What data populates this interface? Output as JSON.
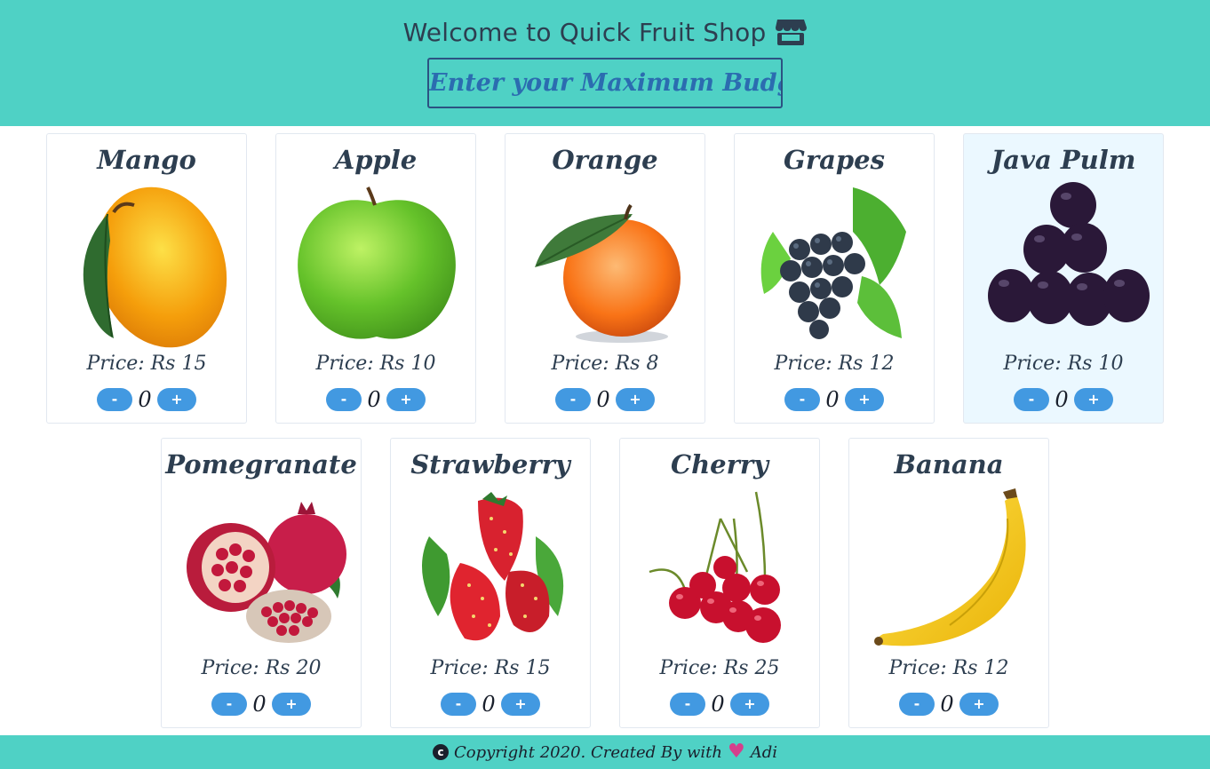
{
  "header": {
    "title": "Welcome to Quick Fruit Shop",
    "budget_placeholder": "Enter your Maximum Budget",
    "shop_icon": "store-icon"
  },
  "fruits": [
    {
      "name": "Mango",
      "price": "Price: Rs 15",
      "qty": "0",
      "icon": "mango-icon"
    },
    {
      "name": "Apple",
      "price": "Price: Rs 10",
      "qty": "0",
      "icon": "apple-icon"
    },
    {
      "name": "Orange",
      "price": "Price: Rs 8",
      "qty": "0",
      "icon": "orange-icon"
    },
    {
      "name": "Grapes",
      "price": "Price: Rs 12",
      "qty": "0",
      "icon": "grapes-icon"
    },
    {
      "name": "Java Pulm",
      "price": "Price: Rs 10",
      "qty": "0",
      "icon": "java-plum-icon"
    },
    {
      "name": "Pomegranate",
      "price": "Price: Rs 20",
      "qty": "0",
      "icon": "pomegranate-icon"
    },
    {
      "name": "Strawberry",
      "price": "Price: Rs 15",
      "qty": "0",
      "icon": "strawberry-icon"
    },
    {
      "name": "Cherry",
      "price": "Price: Rs 25",
      "qty": "0",
      "icon": "cherry-icon"
    },
    {
      "name": "Banana",
      "price": "Price: Rs 12",
      "qty": "0",
      "icon": "banana-icon"
    }
  ],
  "buttons": {
    "minus": "-",
    "plus": "+"
  },
  "footer": {
    "before": "Copyright 2020. Created By with",
    "after": "Adi",
    "copyright_symbol": "c",
    "heart_symbol": "♥"
  },
  "colors": {
    "header_bg": "#4fd1c5",
    "accent_button": "#4299e1",
    "text_dark": "#2d3e50",
    "budget_text": "#2b6cb0",
    "highlight_card": "#ebf8ff"
  }
}
